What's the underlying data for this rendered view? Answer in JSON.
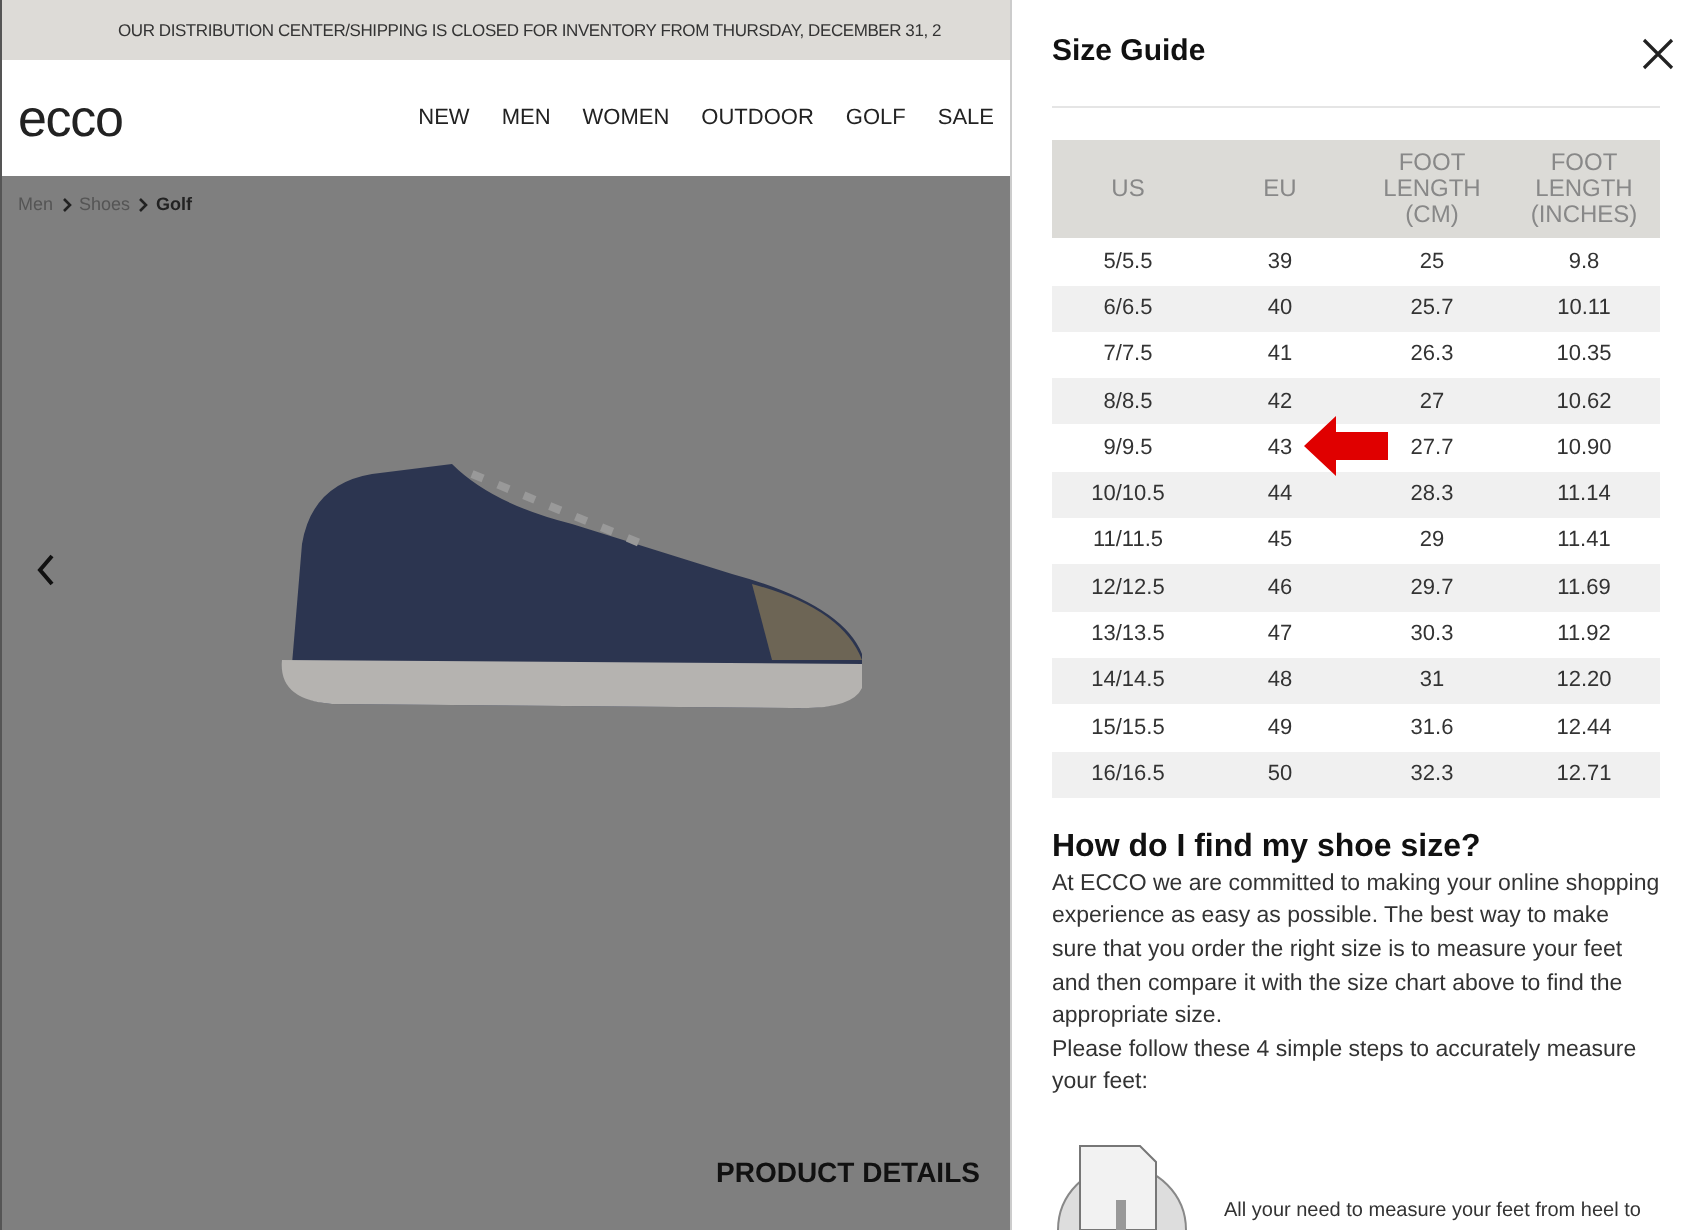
{
  "banner": "OUR DISTRIBUTION CENTER/SHIPPING IS CLOSED FOR INVENTORY FROM THURSDAY, DECEMBER 31, 2",
  "logo": "ecco",
  "nav": [
    "NEW",
    "MEN",
    "WOMEN",
    "OUTDOOR",
    "GOLF",
    "SALE"
  ],
  "breadcrumb": [
    {
      "label": "Men",
      "current": false
    },
    {
      "label": "Shoes",
      "current": false
    },
    {
      "label": "Golf",
      "current": true
    }
  ],
  "product_details": {
    "heading": "PRODUCT DETAILS"
  },
  "size_guide": {
    "title": "Size Guide",
    "columns": [
      "US",
      "EU",
      "FOOT LENGTH (CM)",
      "FOOT LENGTH (INCHES)"
    ],
    "rows": [
      {
        "cells": [
          "5/5.5",
          "39",
          "25",
          "9.8"
        ],
        "highlighted": false
      },
      {
        "cells": [
          "6/6.5",
          "40",
          "25.7",
          "10.11"
        ],
        "highlighted": false
      },
      {
        "cells": [
          "7/7.5",
          "41",
          "26.3",
          "10.35"
        ],
        "highlighted": false
      },
      {
        "cells": [
          "8/8.5",
          "42",
          "27",
          "10.62"
        ],
        "highlighted": false
      },
      {
        "cells": [
          "9/9.5",
          "43",
          "27.7",
          "10.90"
        ],
        "highlighted": true
      },
      {
        "cells": [
          "10/10.5",
          "44",
          "28.3",
          "11.14"
        ],
        "highlighted": false
      },
      {
        "cells": [
          "11/11.5",
          "45",
          "29",
          "11.41"
        ],
        "highlighted": false
      },
      {
        "cells": [
          "12/12.5",
          "46",
          "29.7",
          "11.69"
        ],
        "highlighted": false
      },
      {
        "cells": [
          "13/13.5",
          "47",
          "30.3",
          "11.92"
        ],
        "highlighted": false
      },
      {
        "cells": [
          "14/14.5",
          "48",
          "31",
          "12.20"
        ],
        "highlighted": false
      },
      {
        "cells": [
          "15/15.5",
          "49",
          "31.6",
          "12.44"
        ],
        "highlighted": false
      },
      {
        "cells": [
          "16/16.5",
          "50",
          "32.3",
          "12.71"
        ],
        "highlighted": false
      }
    ],
    "heading": "How do I find my shoe size?",
    "paragraphs": [
      "At ECCO we are committed to making your online shopping experience as easy as possible. The best way to make sure that you order the right size is to measure your feet and then compare it with the size chart above to find the appropriate size.",
      "Please follow these 4 simple steps to accurately measure your feet:"
    ],
    "step_text": "All your need to measure your feet from heel to"
  }
}
